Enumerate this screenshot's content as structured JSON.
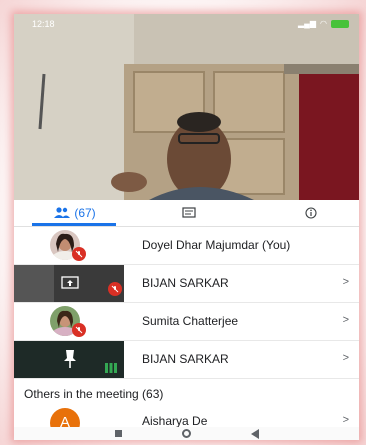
{
  "status_bar": {
    "time": "12:18"
  },
  "tabs": {
    "people_count": "(67)"
  },
  "participants": [
    {
      "name": "Doyel Dhar Majumdar (You)",
      "muted": true,
      "has_chevron": false
    },
    {
      "name": "BIJAN SARKAR",
      "muted": true,
      "has_chevron": true
    },
    {
      "name": "Sumita Chatterjee",
      "muted": true,
      "has_chevron": true
    },
    {
      "name": "BIJAN SARKAR",
      "muted": false,
      "has_chevron": true
    }
  ],
  "chevron": ">",
  "others_section": {
    "title": "Others in the meeting (63)"
  },
  "others": [
    {
      "name": "Aisharya De",
      "initial": "A"
    }
  ],
  "colors": {
    "accent": "#1a73e8",
    "mute": "#d93025",
    "avatar_orange": "#e8710a",
    "audio_green": "#34a853"
  }
}
